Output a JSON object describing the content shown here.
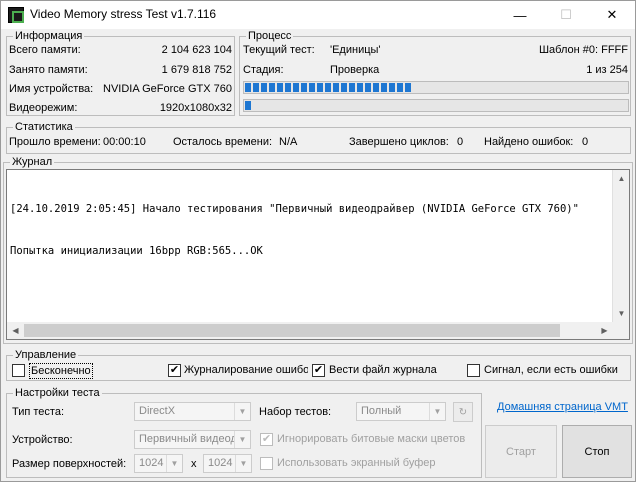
{
  "window": {
    "title": "Video Memory stress Test v1.7.116",
    "minimize": "—",
    "maximize": "☐",
    "close": "✕"
  },
  "info": {
    "title": "Информация",
    "rows": [
      {
        "label": "Всего памяти:",
        "value": "2 104 623 104"
      },
      {
        "label": "Занято памяти:",
        "value": "1 679 818 752"
      },
      {
        "label": "Имя устройства:",
        "value": "NVIDIA GeForce GTX 760"
      },
      {
        "label": "Видеорежим:",
        "value": "1920x1080x32"
      }
    ]
  },
  "process": {
    "title": "Процесс",
    "current_test_label": "Текущий тест:",
    "current_test_value": "'Единицы'",
    "pattern": "Шаблон #0: FFFF",
    "stage_label": "Стадия:",
    "stage_value": "Проверка",
    "stage_count": "1 из 254",
    "progress1": 0.44,
    "progress2": 0.02
  },
  "stats": {
    "title": "Статистика",
    "elapsed_label": "Прошло времени:",
    "elapsed_value": "00:00:10",
    "remaining_label": "Осталось времени:",
    "remaining_value": "N/A",
    "cycles_label": "Завершено циклов:",
    "cycles_value": "0",
    "errors_label": "Найдено ошибок:",
    "errors_value": "0"
  },
  "log": {
    "title": "Журнал",
    "lines": [
      "[24.10.2019 2:05:45] Начало тестирования \"Первичный видеодрайвер (NVIDIA GeForce GTX 760)\"",
      "Попытка инициализации 16bpp RGB:565...OK"
    ]
  },
  "control": {
    "title": "Управление",
    "infinite": {
      "label": "Бесконечно",
      "checked": false
    },
    "error_log": {
      "label": "Журналирование ошибок",
      "checked": true
    },
    "log_file": {
      "label": "Вести файл журнала",
      "checked": true
    },
    "signal": {
      "label": "Сигнал, если есть ошибки",
      "checked": false
    },
    "check_mark": "✔"
  },
  "settings": {
    "title": "Настройки теста",
    "test_type_label": "Тип теста:",
    "test_type_value": "DirectX",
    "test_set_label": "Набор тестов:",
    "test_set_value": "Полный",
    "device_label": "Устройство:",
    "device_value": "Первичный видеодрайвер",
    "surface_label": "Размер поверхностей:",
    "surface_w": "1024",
    "surface_x": "x",
    "surface_h": "1024",
    "ignore_masks": "Игнорировать битовые маски цветов",
    "screen_buffer": "Использовать экранный буфер"
  },
  "actions": {
    "homepage": "Домашняя страница VMT",
    "start": "Старт",
    "stop": "Стоп"
  }
}
